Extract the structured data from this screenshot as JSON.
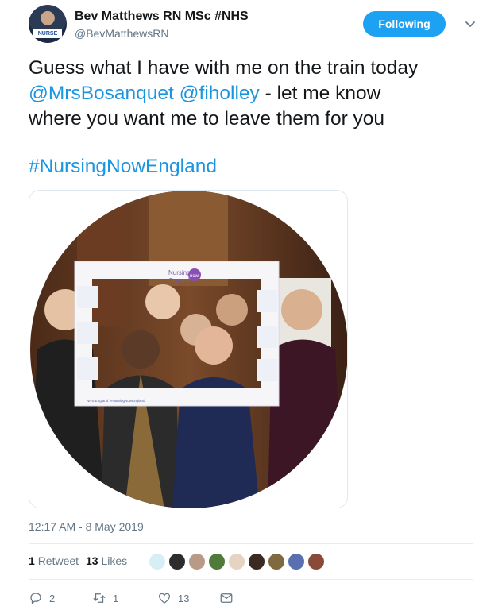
{
  "author": {
    "name": "Bev Matthews RN MSc #NHS",
    "handle": "@BevMatthewsRN",
    "avatar_badge": "NURSE"
  },
  "follow_button_label": "Following",
  "tweet": {
    "line1": "Guess what I have with me on the train today",
    "mention1": "@MrsBosanquet",
    "mention2": "@fiholley",
    "line2_rest": " - let me know",
    "line3": "where you want me to leave them for you",
    "hashtag": "#NursingNowEngland"
  },
  "media": {
    "frame_title_top": "Nursing",
    "frame_title_bottom": "England",
    "frame_badge": "now",
    "frame_footer_left": "NHS England",
    "frame_footer_mid": "#NursingNowEngland"
  },
  "timestamp": "12:17 AM - 8 May 2019",
  "stats": {
    "retweets_count": "1",
    "retweets_label": "Retweet",
    "likes_count": "13",
    "likes_label": "Likes"
  },
  "actions": {
    "reply_count": "2",
    "retweet_count": "1",
    "like_count": "13"
  },
  "icons": [
    "chevron-down-icon",
    "reply-icon",
    "retweet-icon",
    "like-icon",
    "message-icon"
  ],
  "colors": {
    "accent": "#1da1f2",
    "link": "#1b95e0",
    "muted": "#657786"
  }
}
